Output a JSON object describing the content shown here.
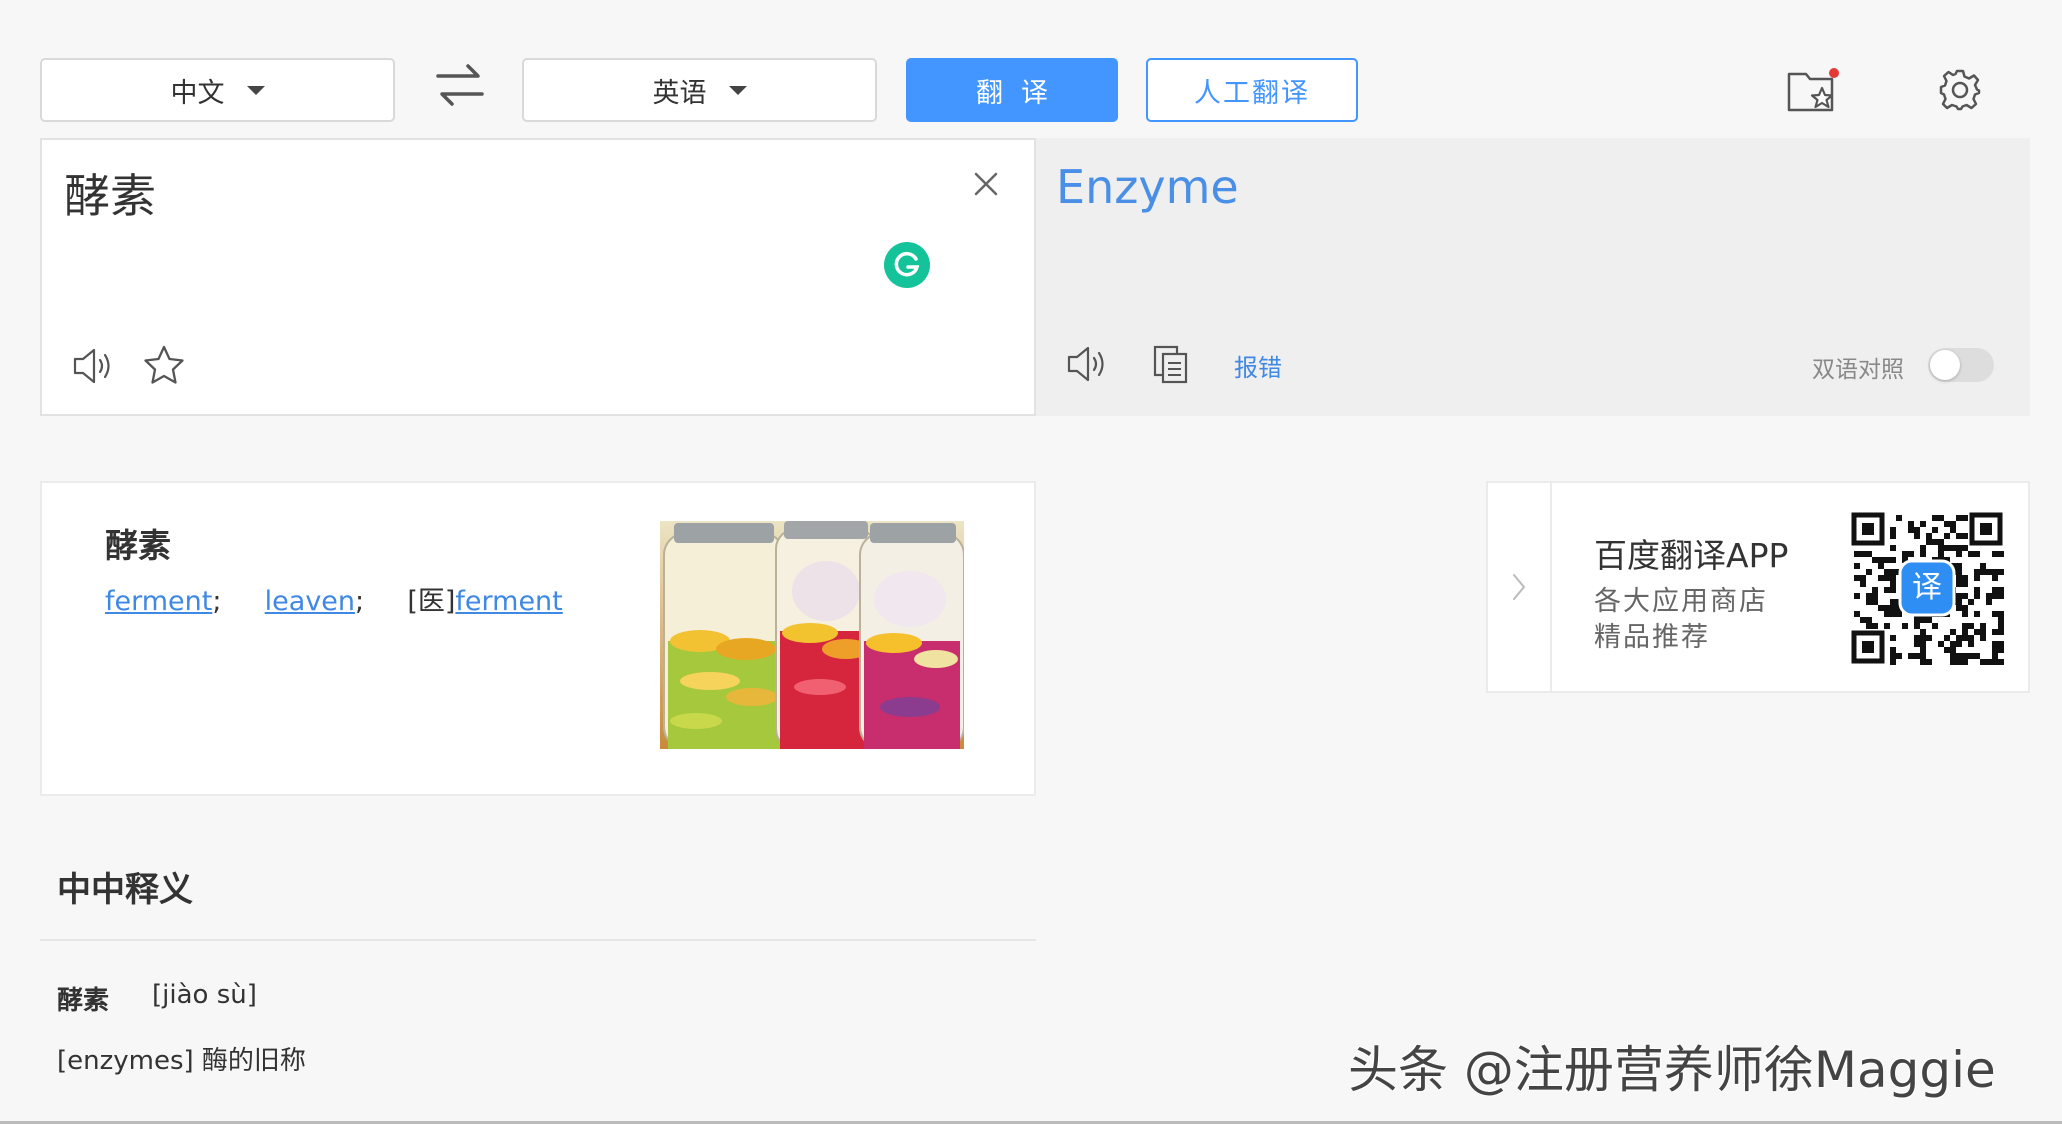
{
  "toolbar": {
    "source_lang": "中文",
    "target_lang": "英语",
    "translate_button": "翻译",
    "human_translate_button": "人工翻译",
    "icons": [
      "swap-icon",
      "favorites-icon",
      "settings-icon"
    ]
  },
  "input": {
    "text": "酵素",
    "icons": [
      "clear-icon",
      "grammarly-icon",
      "speaker-icon",
      "star-icon"
    ]
  },
  "output": {
    "text": "Enzyme",
    "report_error": "报错",
    "bilingual_label": "双语对照",
    "bilingual_enabled": false,
    "icons": [
      "speaker-icon",
      "copy-icon"
    ]
  },
  "dictionary": {
    "word": "酵素",
    "meanings": [
      {
        "prefix": "",
        "text": "ferment",
        "suffix": ";"
      },
      {
        "prefix": "",
        "text": "leaven",
        "suffix": ";"
      },
      {
        "prefix": "[医]",
        "text": "ferment",
        "suffix": ""
      }
    ]
  },
  "app_promo": {
    "title": "百度翻译APP",
    "line1": "各大应用商店",
    "line2": "精品推荐",
    "qr_badge": "译"
  },
  "explanation": {
    "title": "中中释义",
    "word": "酵素",
    "pinyin": "[jiào sù]",
    "definition": "[enzymes] 酶的旧称"
  },
  "watermark": "头条 @注册营养师徐Maggie",
  "colors": {
    "accent": "#4395ff",
    "link": "#3f88e3",
    "grammarly": "#15c39a",
    "notification_dot": "#e53935"
  }
}
